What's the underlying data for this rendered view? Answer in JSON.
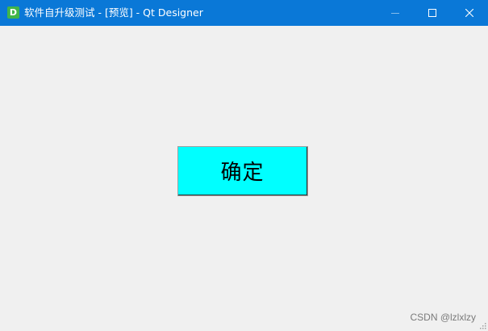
{
  "window": {
    "title": "软件自升级测试 - [预览] - Qt Designer",
    "app_icon_letter": "D",
    "titlebar_color": "#0a78d7",
    "controls": [
      "minimize-icon",
      "maximize-icon",
      "close-icon"
    ]
  },
  "main": {
    "ok_button_label": "确定",
    "ok_button_color": "#00ffff"
  },
  "watermark": "CSDN @lzlxlzy"
}
